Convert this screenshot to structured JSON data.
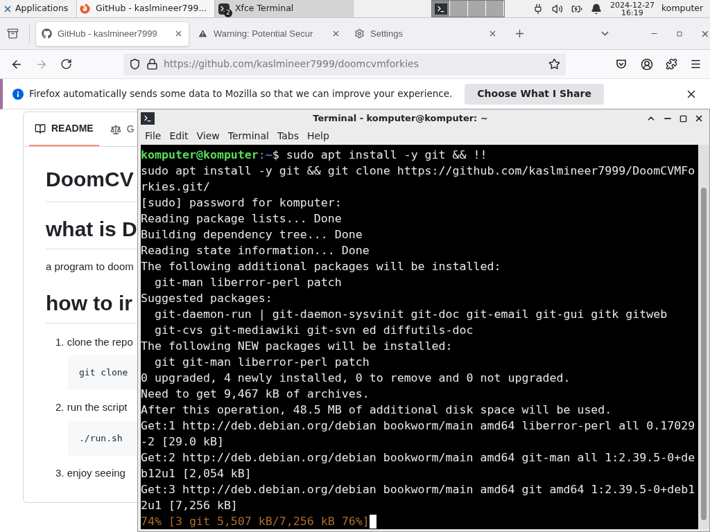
{
  "panel": {
    "menu_label": "Applications",
    "tasks": [
      {
        "label": "GitHub - kaslmineer799...",
        "kind": "browser",
        "selected": false
      },
      {
        "label": "Xfce Terminal",
        "kind": "terminal",
        "badge": "2",
        "selected": true
      }
    ],
    "workspaces": [
      {
        "selected": true
      },
      {
        "selected": false
      },
      {
        "selected": false
      },
      {
        "selected": false
      }
    ],
    "date": "2024-12-27",
    "time": "16:19",
    "user": "komputer"
  },
  "browser": {
    "tabs": [
      {
        "label": "GitHub - kaslmineer7999",
        "kind": "github",
        "selected": true
      },
      {
        "label": "Warning: Potential Secur",
        "kind": "warning",
        "selected": false
      },
      {
        "label": "Settings",
        "kind": "settings",
        "selected": false
      }
    ],
    "url_host": "https://github.com",
    "url_path": "/kaslmineer7999/doomcvmforkies",
    "notification": {
      "text": "Firefox automatically sends some data to Mozilla so that we can improve your experience.",
      "button": "Choose What I Share"
    }
  },
  "page": {
    "tabs": [
      {
        "label": "README",
        "kind": "readme",
        "selected": true
      },
      {
        "label": "G",
        "kind": "license",
        "selected": false
      }
    ],
    "title": "DoomCV",
    "heading_1": "what is D",
    "paragraph": "a program to doom",
    "heading_2": "how to ir",
    "steps": [
      {
        "number": "1.",
        "text": "clone the repo",
        "code": "git clone"
      },
      {
        "number": "2.",
        "text": "run the script",
        "code": "./run.sh"
      },
      {
        "number": "3.",
        "text": "enjoy seeing"
      }
    ]
  },
  "terminal": {
    "title": "Terminal - komputer@komputer: ~",
    "menu": [
      "File",
      "Edit",
      "View",
      "Terminal",
      "Tabs",
      "Help"
    ],
    "lines": [
      {
        "kind": "prompt",
        "user_host": "komputer@komputer",
        "path": ":~",
        "command": "$ sudo apt install -y git && !!"
      },
      {
        "kind": "output",
        "text": "sudo apt install -y git && git clone https://github.com/kaslmineer7999/DoomCVMFo"
      },
      {
        "kind": "output",
        "text": "rkies.git/"
      },
      {
        "kind": "output",
        "text": "[sudo] password for komputer:"
      },
      {
        "kind": "output",
        "text": "Reading package lists... Done"
      },
      {
        "kind": "output",
        "text": "Building dependency tree... Done"
      },
      {
        "kind": "output",
        "text": "Reading state information... Done"
      },
      {
        "kind": "output",
        "text": "The following additional packages will be installed:"
      },
      {
        "kind": "output",
        "text": "  git-man liberror-perl patch"
      },
      {
        "kind": "output",
        "text": "Suggested packages:"
      },
      {
        "kind": "output",
        "text": "  git-daemon-run | git-daemon-sysvinit git-doc git-email git-gui gitk gitweb"
      },
      {
        "kind": "output",
        "text": "  git-cvs git-mediawiki git-svn ed diffutils-doc"
      },
      {
        "kind": "output",
        "text": "The following NEW packages will be installed:"
      },
      {
        "kind": "output",
        "text": "  git git-man liberror-perl patch"
      },
      {
        "kind": "output",
        "text": "0 upgraded, 4 newly installed, 0 to remove and 0 not upgraded."
      },
      {
        "kind": "output",
        "text": "Need to get 9,467 kB of archives."
      },
      {
        "kind": "output",
        "text": "After this operation, 48.5 MB of additional disk space will be used."
      },
      {
        "kind": "output",
        "text": "Get:1 http://deb.debian.org/debian bookworm/main amd64 liberror-perl all 0.17029"
      },
      {
        "kind": "output",
        "text": "-2 [29.0 kB]"
      },
      {
        "kind": "output",
        "text": "Get:2 http://deb.debian.org/debian bookworm/main amd64 git-man all 1:2.39.5-0+de"
      },
      {
        "kind": "output",
        "text": "b12u1 [2,054 kB]"
      },
      {
        "kind": "output",
        "text": "Get:3 http://deb.debian.org/debian bookworm/main amd64 git amd64 1:2.39.5-0+deb1"
      },
      {
        "kind": "output",
        "text": "2u1 [7,256 kB]"
      },
      {
        "kind": "progress",
        "text": "74% [3 git 5,507 kB/7,256 kB 76%]",
        "cursor": true
      }
    ]
  }
}
